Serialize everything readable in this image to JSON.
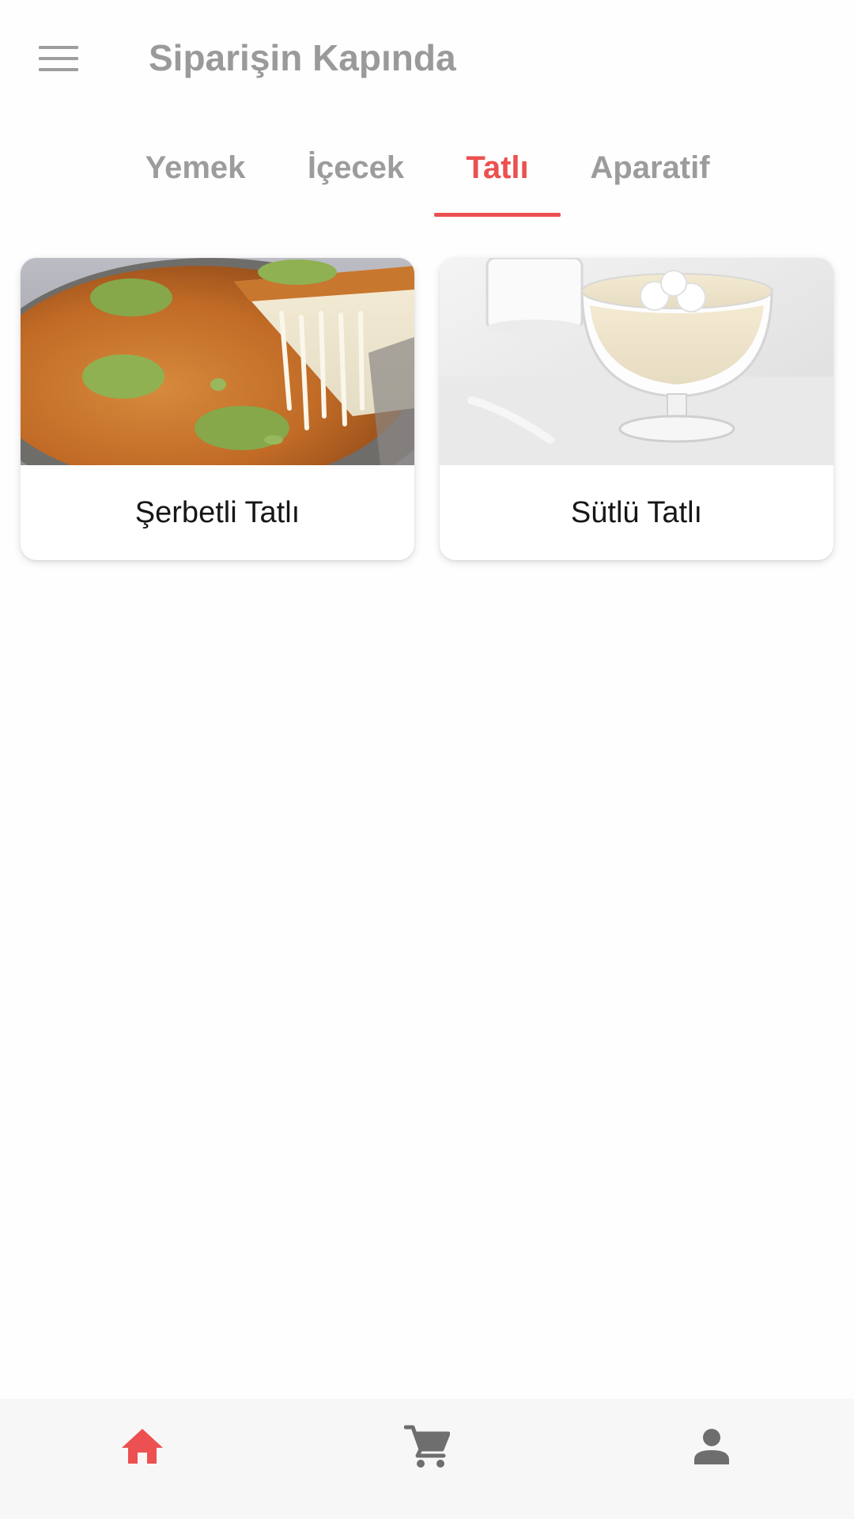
{
  "app_bar": {
    "title": "Siparişin Kapında",
    "menu_icon": "menu-icon"
  },
  "tabs": [
    {
      "label": "Yemek",
      "active": false
    },
    {
      "label": "İçecek",
      "active": false
    },
    {
      "label": "Tatlı",
      "active": true
    },
    {
      "label": "Aparatif",
      "active": false
    }
  ],
  "categories": [
    {
      "label": "Şerbetli Tatlı",
      "image": "kunefe-dessert-photo"
    },
    {
      "label": "Sütlü Tatlı",
      "image": "milk-pudding-photo"
    }
  ],
  "bottom_nav": [
    {
      "icon": "home-icon",
      "active": true
    },
    {
      "icon": "cart-icon",
      "active": false
    },
    {
      "icon": "person-icon",
      "active": false
    }
  ],
  "colors": {
    "accent": "#ec5050",
    "inactive_text": "#9c9c9c",
    "inactive_icon": "#6e6e6e"
  }
}
